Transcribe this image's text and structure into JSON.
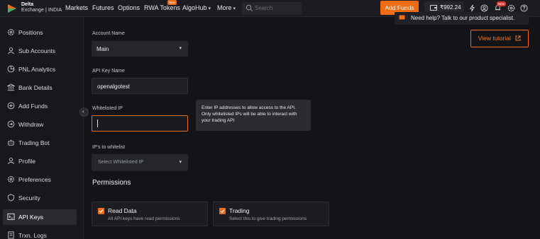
{
  "brand": {
    "line1": "Delta",
    "line2": "Exchange | INDIA",
    "accent": "#ef6c12"
  },
  "nav": {
    "items": [
      "Markets",
      "Futures",
      "Options",
      "RWA Tokens",
      "AlgoHub",
      "More"
    ],
    "rwa_badge": "New",
    "search_placeholder": "Search",
    "add_funds": "Add Funds",
    "wallet_value": "₹992.24",
    "notif_badge": "New"
  },
  "sidebar": {
    "items": [
      {
        "label": "Positions",
        "icon": "gear-icon"
      },
      {
        "label": "Sub Accounts",
        "icon": "user-icon"
      },
      {
        "label": "PNL Analytics",
        "icon": "pie-chart-icon"
      },
      {
        "label": "Bank Details",
        "icon": "bank-icon"
      },
      {
        "label": "Add Funds",
        "icon": "plus-circle-icon"
      },
      {
        "label": "Withdraw",
        "icon": "withdraw-icon"
      },
      {
        "label": "Trading Bot",
        "icon": "bot-icon"
      },
      {
        "label": "Profile",
        "icon": "profile-icon"
      },
      {
        "label": "Preferences",
        "icon": "preferences-icon"
      },
      {
        "label": "Security",
        "icon": "shield-icon"
      },
      {
        "label": "API Keys",
        "icon": "terminal-icon"
      },
      {
        "label": "Trxn. Logs",
        "icon": "logs-icon"
      }
    ],
    "active_index": 10
  },
  "form": {
    "account_name_label": "Account Name",
    "account_name_value": "Main",
    "api_key_name_label": "API Key Name",
    "api_key_name_value": "openalgotest",
    "whitelisted_ip_label": "Whitelisted IP",
    "whitelisted_ip_value": "",
    "ips_to_whitelist_label": "IP's to whitelist",
    "ips_select_placeholder": "Select Whitelisted IP",
    "tooltip": "Enter IP addresses to allow access to the API. Only whitelisted IPs will be able to interact with your trading API"
  },
  "permissions": {
    "title": "Permissions",
    "items": [
      {
        "title": "Read Data",
        "desc": "All API keys have read permissions",
        "checked": true
      },
      {
        "title": "Trading",
        "desc": "Select this to give trading permissions",
        "checked": true
      }
    ]
  },
  "help": {
    "text": "Need help? Talk to our product specialist.",
    "tutorial": "View tutorial"
  }
}
